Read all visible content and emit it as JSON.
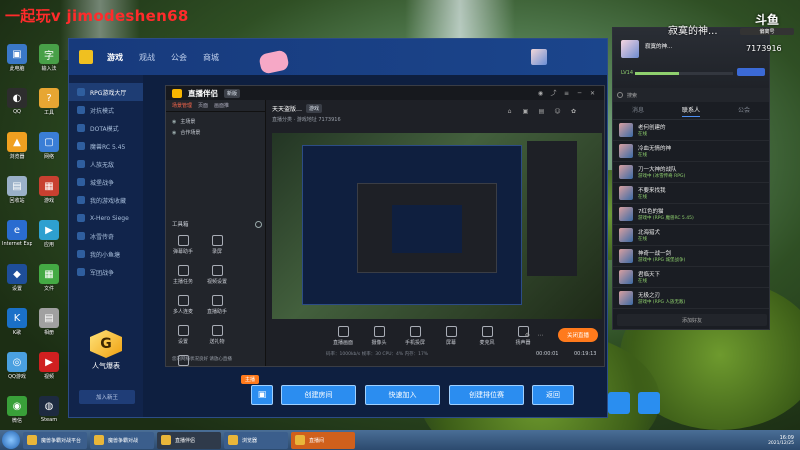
{
  "overlay": {
    "watermark": "一起玩v jimodeshen68",
    "stream_title": "寂寞的神...",
    "stream_id": "7173916",
    "logo_text": "斗鱼",
    "logo_sub": "偏离号"
  },
  "desktop_icons": [
    {
      "label": "此电脑",
      "color": "#3a78c8",
      "glyph": "▣"
    },
    {
      "label": "输入法",
      "color": "#48a048",
      "glyph": "字"
    },
    {
      "label": "QQ",
      "color": "#2d2d2d",
      "glyph": "◐"
    },
    {
      "label": "工具",
      "color": "#e7a632",
      "glyph": "?"
    },
    {
      "label": "浏览器",
      "color": "#f0a020",
      "glyph": "▲"
    },
    {
      "label": "网络",
      "color": "#3a7ed6",
      "glyph": "▢"
    },
    {
      "label": "回收站",
      "color": "#9ab0c8",
      "glyph": "▤"
    },
    {
      "label": "游戏",
      "color": "#c84030",
      "glyph": "▦"
    },
    {
      "label": "Internet Explorer",
      "color": "#2a6cd0",
      "glyph": "e"
    },
    {
      "label": "应用",
      "color": "#2ea0d0",
      "glyph": "▶"
    },
    {
      "label": "设置",
      "color": "#1e4e9a",
      "glyph": "◆"
    },
    {
      "label": "文件",
      "color": "#44aa44",
      "glyph": "▦"
    },
    {
      "label": "K歌",
      "color": "#1a70c8",
      "glyph": "K"
    },
    {
      "label": "相册",
      "color": "#a0a0a0",
      "glyph": "▤"
    },
    {
      "label": "QQ游戏",
      "color": "#4aa0e0",
      "glyph": "◎"
    },
    {
      "label": "视频",
      "color": "#d02020",
      "glyph": "▶"
    },
    {
      "label": "微信",
      "color": "#39a039",
      "glyph": "◉"
    },
    {
      "label": "Steam",
      "color": "#1d2a40",
      "glyph": "◍"
    }
  ],
  "platform": {
    "nav": [
      "游戏",
      "观战",
      "公会",
      "商城"
    ],
    "menu": [
      "RPG游戏大厅",
      "对抗模式",
      "DOTA模式",
      "魔兽RC 5.45",
      "人族无敌",
      "城堡战争",
      "我的游戏收藏",
      "X-Hero Siege",
      "冰雪传奇",
      "我的小鱼塘",
      "军团战争"
    ],
    "brand": "人气爆表",
    "bottom": "加入新王",
    "buttons": {
      "create_room": "创建房间",
      "quick_join": "快速加入",
      "rank_room": "创建排位赛",
      "back": "返回"
    },
    "badge": "主播"
  },
  "obs": {
    "app_name": "直播伴侣",
    "version": "新版",
    "tabs": [
      "场景管理",
      "页面",
      "画面推"
    ],
    "scenes": [
      "主场景",
      "合作场景"
    ],
    "toolbox_title": "工具箱",
    "tools": [
      "弹幕助手",
      "录屏",
      "主播任务",
      "视频设置",
      "多人连麦",
      "直播助手",
      "设置",
      "送礼物",
      "直播间"
    ],
    "room_title": "天天盗版…",
    "room_tag": "游戏",
    "info": "直播分类 ·  游戏地址 7173916",
    "bottom_tools": [
      "直播画面",
      "摄像头",
      "手机投屏",
      "屏幕",
      "麦克风",
      "扬声器"
    ],
    "live_button": "关闭直播",
    "time_left": "00:00:01",
    "time_right": "00:19:13",
    "status": "您的网络状况良好 请放心直播",
    "stats": "码率：1000kb/s   帧率：30   CPU：4%   内存：17%"
  },
  "chat": {
    "nickname": "寂寞的神...",
    "level": "LV14",
    "level_progress": 0.45,
    "search": "搜索",
    "tabs": [
      "消息",
      "联系人",
      "公会"
    ],
    "contacts": [
      {
        "name": "老何创建的",
        "status": "在线"
      },
      {
        "name": "冷血无情的神",
        "status": "在线"
      },
      {
        "name": "刀一大神的战队",
        "status": "游戏中 (冰雪传奇 RPG)"
      },
      {
        "name": "不要来找我",
        "status": "在线"
      },
      {
        "name": "7红色的猫",
        "status": "游戏中 (RPG 魔兽RC 5.45)"
      },
      {
        "name": "北海猎犬",
        "status": "在线"
      },
      {
        "name": "神奇一战一剑",
        "status": "游戏中 (RPG 城堡战争)"
      },
      {
        "name": "君临天下",
        "status": "在线"
      },
      {
        "name": "无极之刃",
        "status": "游戏中 (RPG 人族无敌)"
      }
    ],
    "footer": "添加好友"
  },
  "taskbar": {
    "items": [
      "魔兽争霸对战平台",
      "魔兽争霸对战",
      "直播伴侣",
      "浏览器",
      "直播间"
    ],
    "time": "16:09",
    "date": "2021/12/25"
  }
}
